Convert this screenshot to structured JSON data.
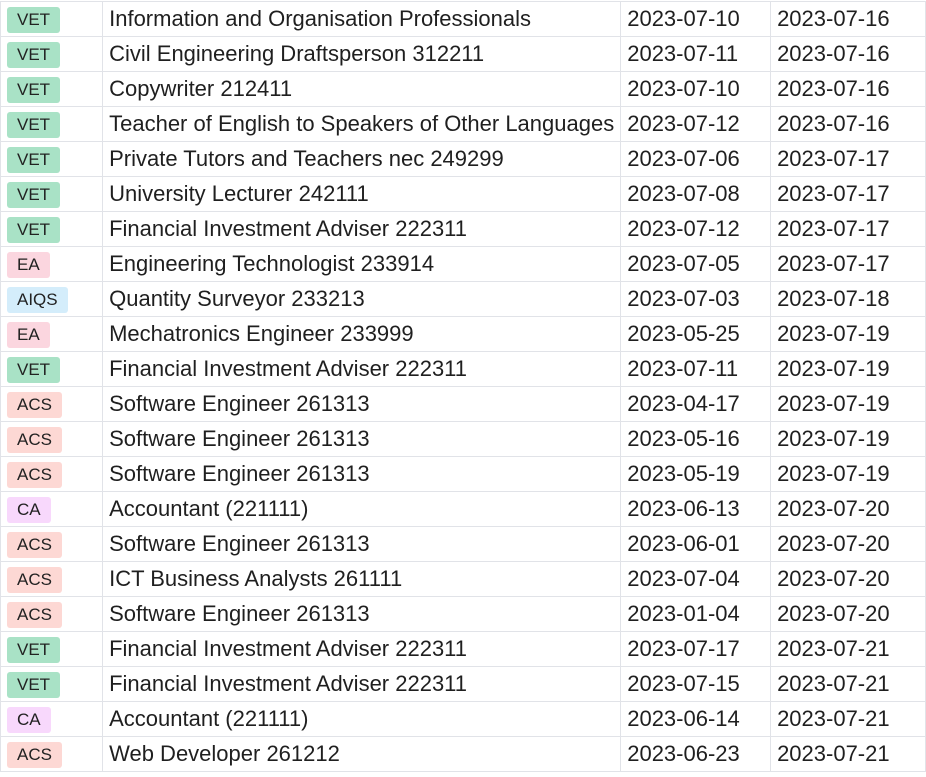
{
  "badge_colors": {
    "VET": "#a9e2c6",
    "EA": "#fbd6df",
    "AIQS": "#d4edfb",
    "ACS": "#fdd8d4",
    "CA": "#f8d8fc"
  },
  "rows": [
    {
      "body": "VET",
      "occupation": "Information and Organisation Professionals",
      "date1": "2023-07-10",
      "date2": "2023-07-16"
    },
    {
      "body": "VET",
      "occupation": "Civil Engineering Draftsperson 312211",
      "date1": "2023-07-11",
      "date2": "2023-07-16"
    },
    {
      "body": "VET",
      "occupation": "Copywriter 212411",
      "date1": "2023-07-10",
      "date2": "2023-07-16"
    },
    {
      "body": "VET",
      "occupation": "Teacher of English to Speakers of Other Languages",
      "date1": "2023-07-12",
      "date2": "2023-07-16"
    },
    {
      "body": "VET",
      "occupation": "Private Tutors and Teachers nec 249299",
      "date1": "2023-07-06",
      "date2": "2023-07-17"
    },
    {
      "body": "VET",
      "occupation": "University Lecturer 242111",
      "date1": "2023-07-08",
      "date2": "2023-07-17"
    },
    {
      "body": "VET",
      "occupation": "Financial Investment Adviser 222311",
      "date1": "2023-07-12",
      "date2": "2023-07-17"
    },
    {
      "body": "EA",
      "occupation": "Engineering Technologist 233914",
      "date1": "2023-07-05",
      "date2": "2023-07-17"
    },
    {
      "body": "AIQS",
      "occupation": "Quantity Surveyor 233213",
      "date1": "2023-07-03",
      "date2": "2023-07-18"
    },
    {
      "body": "EA",
      "occupation": "Mechatronics Engineer 233999",
      "date1": "2023-05-25",
      "date2": "2023-07-19"
    },
    {
      "body": "VET",
      "occupation": "Financial Investment Adviser 222311",
      "date1": "2023-07-11",
      "date2": "2023-07-19"
    },
    {
      "body": "ACS",
      "occupation": "Software Engineer 261313",
      "date1": "2023-04-17",
      "date2": "2023-07-19"
    },
    {
      "body": "ACS",
      "occupation": "Software Engineer 261313",
      "date1": "2023-05-16",
      "date2": "2023-07-19"
    },
    {
      "body": "ACS",
      "occupation": "Software Engineer 261313",
      "date1": "2023-05-19",
      "date2": "2023-07-19"
    },
    {
      "body": "CA",
      "occupation": "Accountant (221111)",
      "date1": "2023-06-13",
      "date2": "2023-07-20"
    },
    {
      "body": "ACS",
      "occupation": "Software Engineer 261313",
      "date1": "2023-06-01",
      "date2": "2023-07-20"
    },
    {
      "body": "ACS",
      "occupation": "ICT Business Analysts 261111",
      "date1": "2023-07-04",
      "date2": "2023-07-20"
    },
    {
      "body": "ACS",
      "occupation": "Software Engineer 261313",
      "date1": "2023-01-04",
      "date2": "2023-07-20"
    },
    {
      "body": "VET",
      "occupation": "Financial Investment Adviser 222311",
      "date1": "2023-07-17",
      "date2": "2023-07-21"
    },
    {
      "body": "VET",
      "occupation": "Financial Investment Adviser 222311",
      "date1": "2023-07-15",
      "date2": "2023-07-21"
    },
    {
      "body": "CA",
      "occupation": "Accountant (221111)",
      "date1": "2023-06-14",
      "date2": "2023-07-21"
    },
    {
      "body": "ACS",
      "occupation": "Web Developer 261212",
      "date1": "2023-06-23",
      "date2": "2023-07-21"
    }
  ]
}
